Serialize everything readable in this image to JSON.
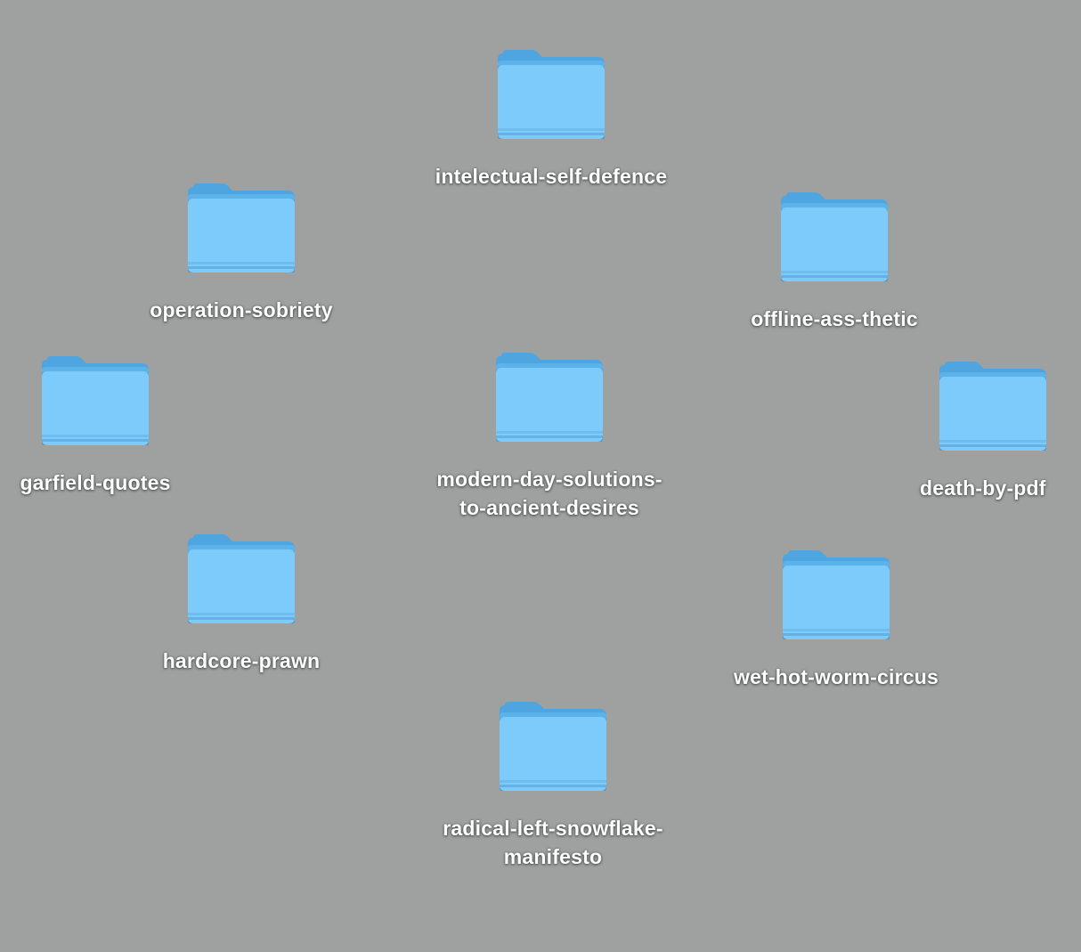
{
  "desktop": {
    "background_color": "#9ea1a0",
    "folder_color": "#7dcbfa",
    "folders": [
      {
        "label": "intelectual-self-defence",
        "icon": "folder-icon"
      },
      {
        "label": "operation-sobriety",
        "icon": "folder-icon"
      },
      {
        "label": "offline-ass-thetic",
        "icon": "folder-icon"
      },
      {
        "label": "garfield-quotes",
        "icon": "folder-icon"
      },
      {
        "label": "modern-day-solutions-\nto-ancient-desires",
        "icon": "folder-icon"
      },
      {
        "label": "death-by-pdf",
        "icon": "folder-icon"
      },
      {
        "label": "hardcore-prawn",
        "icon": "folder-icon"
      },
      {
        "label": "wet-hot-worm-circus",
        "icon": "folder-icon"
      },
      {
        "label": "radical-left-snowflake-\nmanifesto",
        "icon": "folder-icon"
      }
    ]
  }
}
